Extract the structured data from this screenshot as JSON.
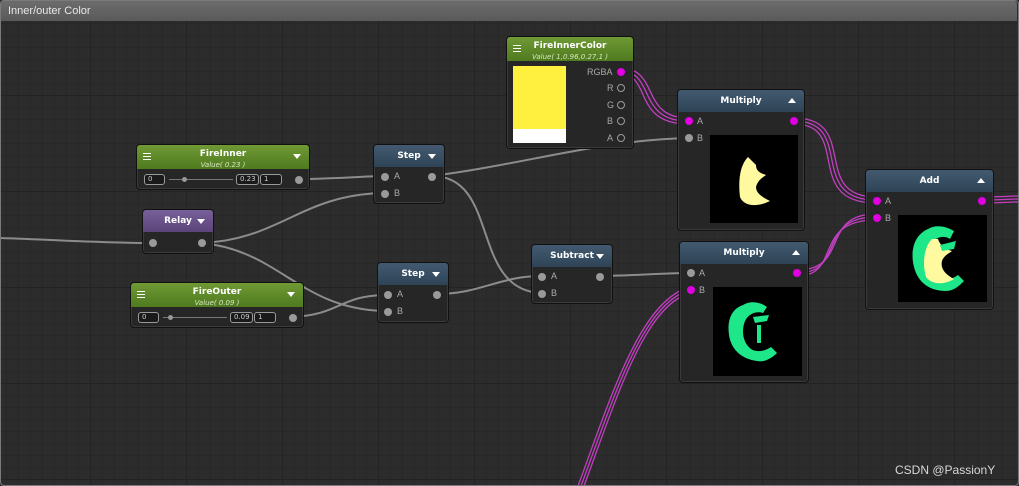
{
  "window": {
    "title": "Inner/outer Color"
  },
  "colors": {
    "wire_gray": "#8c8c8c",
    "wire_magenta": "#c23fc2",
    "port_magenta": "#e000e0",
    "swatch_yellow": "#fff03f"
  },
  "nodes": {
    "fire_inner_color": {
      "title": "FireInnerColor",
      "value": "Value( 1,0.96,0.27,1 )",
      "ports": [
        "RGBA",
        "R",
        "G",
        "B",
        "A"
      ]
    },
    "fire_inner": {
      "title": "FireInner",
      "value": "Value( 0.23 )",
      "min": "0",
      "current": "0.23",
      "max": "1"
    },
    "relay": {
      "title": "Relay"
    },
    "fire_outer": {
      "title": "FireOuter",
      "value": "Value( 0.09 )",
      "min": "0",
      "current": "0.09",
      "max": "1"
    },
    "step1": {
      "title": "Step",
      "ports": [
        "A",
        "B"
      ]
    },
    "step2": {
      "title": "Step",
      "ports": [
        "A",
        "B"
      ]
    },
    "subtract": {
      "title": "Subtract",
      "ports": [
        "A",
        "B"
      ]
    },
    "multiply1": {
      "title": "Multiply",
      "ports": [
        "A",
        "B"
      ]
    },
    "multiply2": {
      "title": "Multiply",
      "ports": [
        "A",
        "B"
      ]
    },
    "add": {
      "title": "Add",
      "ports": [
        "A",
        "B"
      ]
    }
  },
  "watermark": "CSDN @PassionY"
}
